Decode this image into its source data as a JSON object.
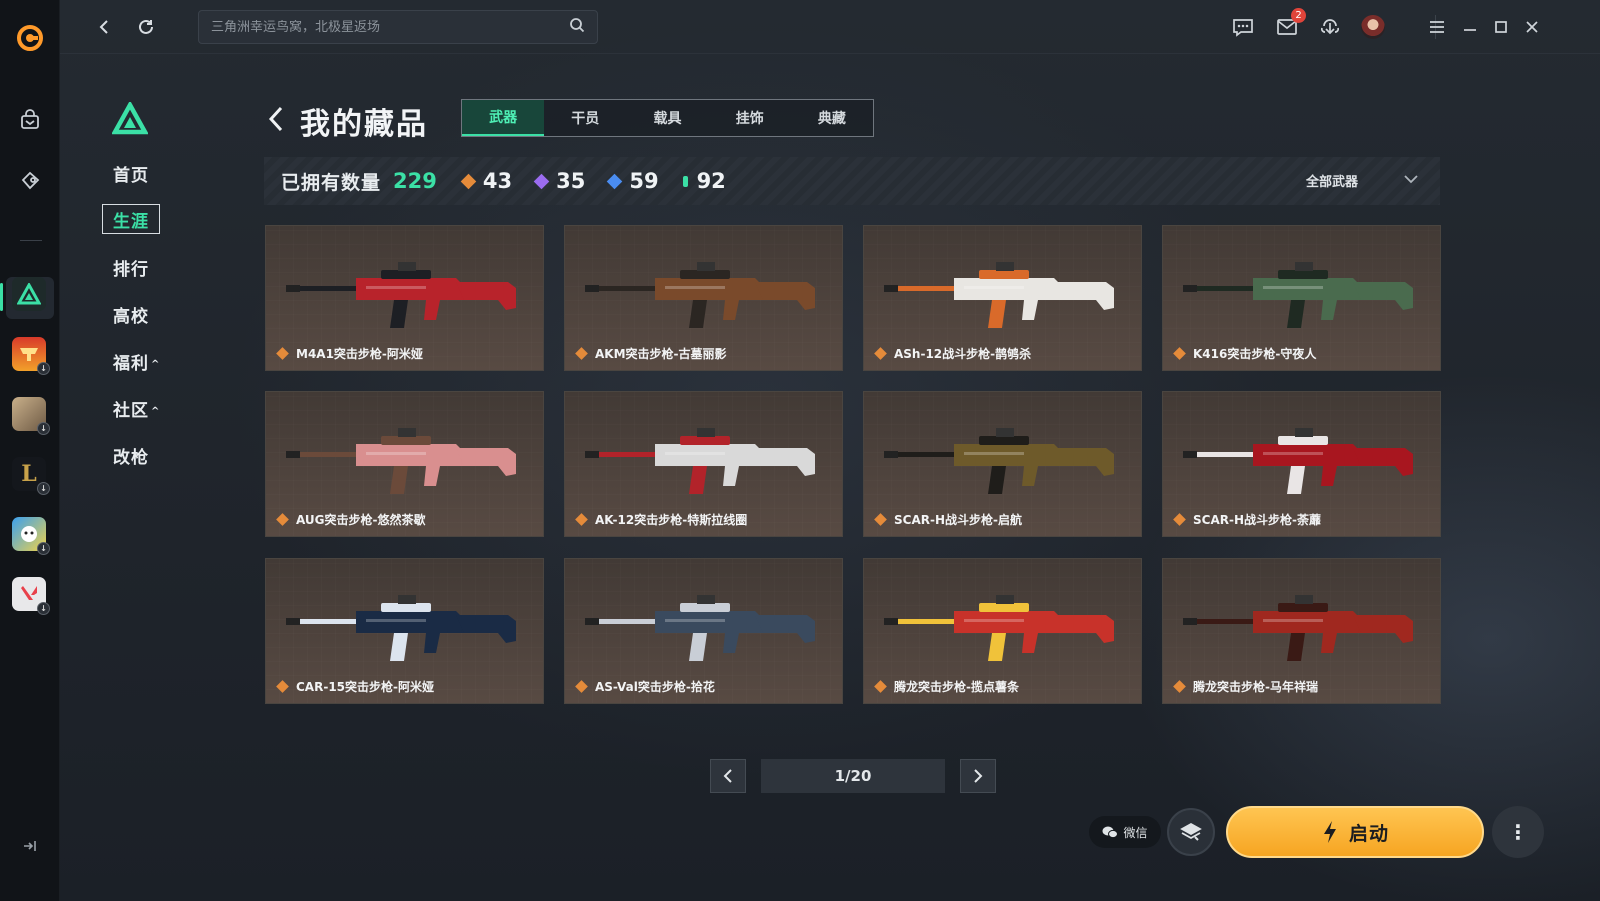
{
  "colors": {
    "accent": "#3be0a6",
    "launch": "#f6a522",
    "badge": "#e0443a",
    "legendary": "#e58b3a",
    "epic": "#9b6cf0",
    "rare": "#4a8cf0",
    "common": "#3be0a6"
  },
  "topbar": {
    "search_placeholder": "三角洲幸运鸟窝，北极星返场",
    "mail_badge": "2"
  },
  "sidebar": {
    "items": [
      {
        "label": "首页"
      },
      {
        "label": "生涯"
      },
      {
        "label": "排行"
      },
      {
        "label": "高校"
      },
      {
        "label": "福利",
        "caret": "^"
      },
      {
        "label": "社区",
        "caret": "^"
      },
      {
        "label": "改枪"
      }
    ]
  },
  "main": {
    "title": "我的藏品",
    "tabs": [
      {
        "label": "武器"
      },
      {
        "label": "干员"
      },
      {
        "label": "载具"
      },
      {
        "label": "挂饰"
      },
      {
        "label": "典藏"
      }
    ],
    "stats": {
      "label": "已拥有数量",
      "total": "229",
      "rarity_counts": [
        {
          "value": "43",
          "color": "#e58b3a"
        },
        {
          "value": "35",
          "color": "#9b6cf0"
        },
        {
          "value": "59",
          "color": "#4a8cf0"
        },
        {
          "value": "92",
          "color": "#3be0a6"
        }
      ],
      "filter": "全部武器"
    },
    "items": [
      {
        "name": "M4A1突击步枪-阿米娅",
        "c1": "#b8232b",
        "c2": "#1d1f24"
      },
      {
        "name": "AKM突击步枪-古墓丽影",
        "c1": "#7a4a2b",
        "c2": "#2b2622"
      },
      {
        "name": "ASh-12战斗步枪-鹊鸲杀",
        "c1": "#e8e6e2",
        "c2": "#d96a2a"
      },
      {
        "name": "K416突击步枪-守夜人",
        "c1": "#4a6b4e",
        "c2": "#1f2a22"
      },
      {
        "name": "AUG突击步枪-悠然茶歇",
        "c1": "#d98f8f",
        "c2": "#6b4a3a"
      },
      {
        "name": "AK-12突击步枪-特斯拉线圈",
        "c1": "#d9d9d9",
        "c2": "#b2232a"
      },
      {
        "name": "SCAR-H战斗步枪-启航",
        "c1": "#6e5a2a",
        "c2": "#1f1d1a"
      },
      {
        "name": "SCAR-H战斗步枪-荼蘼",
        "c1": "#a8161f",
        "c2": "#e9e5e5"
      },
      {
        "name": "CAR-15突击步枪-阿米娅",
        "c1": "#1a2b45",
        "c2": "#dce4ee"
      },
      {
        "name": "AS-Val突击步枪-拾花",
        "c1": "#3a4a5e",
        "c2": "#c9ced6"
      },
      {
        "name": "腾龙突击步枪-揽点薯条",
        "c1": "#c8322a",
        "c2": "#f0c23a"
      },
      {
        "name": "腾龙突击步枪-马年祥瑞",
        "c1": "#a0281f",
        "c2": "#3a1a15"
      }
    ],
    "pagination": {
      "current": "1/20"
    }
  },
  "footer": {
    "wechat_label": "微信",
    "launch_label": "启动"
  }
}
